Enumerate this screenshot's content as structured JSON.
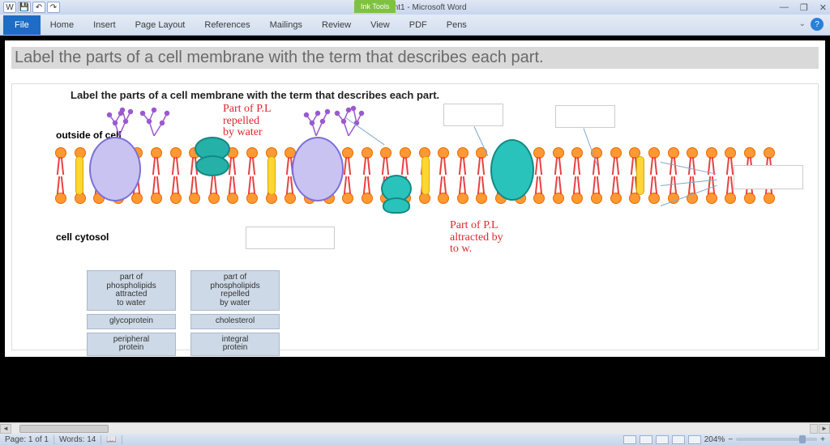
{
  "window": {
    "title": "Document1 - Microsoft Word",
    "ink_tools": "Ink Tools"
  },
  "tabs": {
    "file": "File",
    "items": [
      "Home",
      "Insert",
      "Page Layout",
      "References",
      "Mailings",
      "Review",
      "View",
      "PDF",
      "Pens"
    ]
  },
  "document": {
    "heading": "Label the parts of a cell membrane with the term that describes each part.",
    "diagram": {
      "title": "Label the parts of a cell membrane with the term that describes each part.",
      "outside_label": "outside of cell",
      "cytosol_label": "cell cytosol",
      "ink_annotations": {
        "repelled": "Part of P.L\nrepelled\nby water",
        "attracted": "Part of P.L\naltracted by\nto w."
      },
      "word_bank": [
        "part of\nphospholipids\nattracted\nto water",
        "part of\nphospholipids\nrepelled\nby water",
        "glycoprotein",
        "cholesterol",
        "peripheral\nprotein",
        "integral\nprotein"
      ]
    }
  },
  "status": {
    "page": "Page: 1 of 1",
    "words": "Words: 14",
    "zoom": "204%"
  },
  "icons": {
    "minimize": "—",
    "maximize": "❐",
    "close": "✕",
    "help": "?",
    "chevron": "⌄",
    "word_logo": "W",
    "save": "💾",
    "undo": "↶",
    "redo": "↷",
    "left_arrow": "◄",
    "right_arrow": "►",
    "zoom_minus": "−",
    "zoom_plus": "+"
  }
}
